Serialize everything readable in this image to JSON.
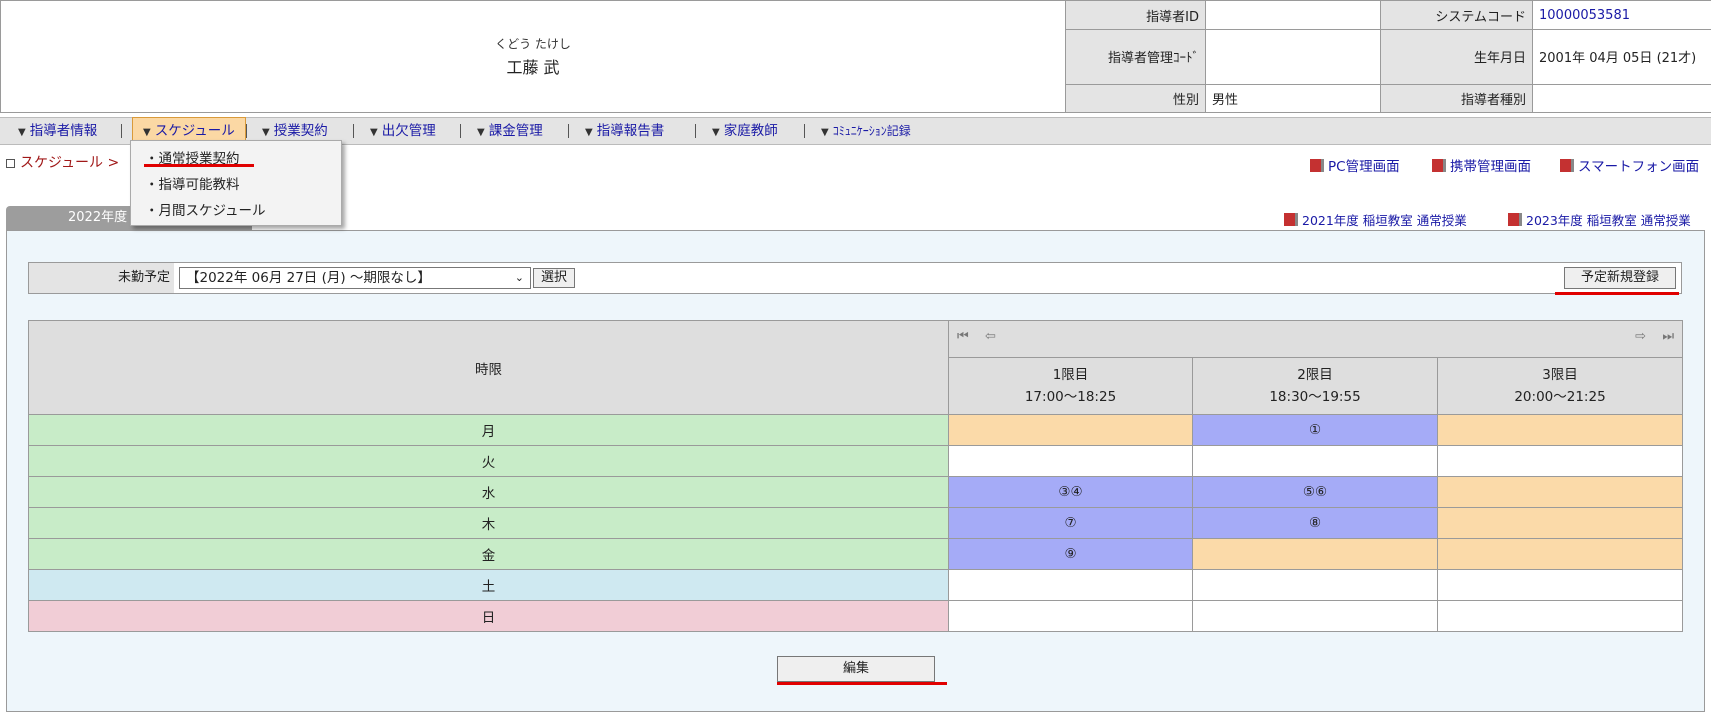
{
  "header": {
    "name_kana": "くどう たけし",
    "name_kanji": "工藤 武",
    "rows": [
      {
        "label1": "指導者ID",
        "value1": "",
        "label2": "システムコード",
        "value2": "10000053581"
      },
      {
        "label1": "指導者管理ｺｰﾄﾞ",
        "value1": "",
        "label2": "生年月日",
        "value2": "2001年 04月 05日 (21才)"
      },
      {
        "label1": "性別",
        "value1": "男性",
        "label2": "指導者種別",
        "value2": ""
      }
    ]
  },
  "nav": {
    "items": [
      "指導者情報",
      "スケジュール",
      "授業契約",
      "出欠管理",
      "課金管理",
      "指導報告書",
      "家庭教師",
      "ｺﾐｭﾆｹｰｼｮﾝ記録"
    ],
    "arrow": "▼",
    "active": "スケジュール"
  },
  "dropdown": {
    "items": [
      "・通常授業契約",
      "・指導可能教料",
      "・月間スケジュール"
    ]
  },
  "breadcrumb": "スケジュール >",
  "screen_links": [
    "PC管理画面",
    "携帯管理画面",
    "スマートフォン画面"
  ],
  "year_tab": "2022年度",
  "year_links": [
    "2021年度 稲垣教室 通常授業",
    "2023年度 稲垣教室 通常授業"
  ],
  "selection": {
    "label": "未勤予定",
    "value": "【2022年 06月 27日 (月) ～期限なし】",
    "select_button": "選択",
    "new_button": "予定新規登録"
  },
  "schedule": {
    "period_header": "時限",
    "nav_icons": [
      "first-icon",
      "prev-icon",
      "next-icon",
      "last-icon"
    ],
    "periods": [
      {
        "name": "1限目",
        "time": "17:00～18:25"
      },
      {
        "name": "2限目",
        "time": "18:30～19:55"
      },
      {
        "name": "3限目",
        "time": "20:00～21:25"
      }
    ],
    "days": [
      {
        "day": "月",
        "type": "weekday",
        "cells": [
          {
            "text": "",
            "color": "orange"
          },
          {
            "text": "①",
            "color": "blue"
          },
          {
            "text": "",
            "color": "orange"
          }
        ]
      },
      {
        "day": "火",
        "type": "weekday",
        "cells": [
          {
            "text": "",
            "color": "white"
          },
          {
            "text": "",
            "color": "white"
          },
          {
            "text": "",
            "color": "white"
          }
        ]
      },
      {
        "day": "水",
        "type": "weekday",
        "cells": [
          {
            "text": "③④",
            "color": "blue"
          },
          {
            "text": "⑤⑥",
            "color": "blue"
          },
          {
            "text": "",
            "color": "orange"
          }
        ]
      },
      {
        "day": "木",
        "type": "weekday",
        "cells": [
          {
            "text": "⑦",
            "color": "blue"
          },
          {
            "text": "⑧",
            "color": "blue"
          },
          {
            "text": "",
            "color": "orange"
          }
        ]
      },
      {
        "day": "金",
        "type": "weekday",
        "cells": [
          {
            "text": "⑨",
            "color": "blue"
          },
          {
            "text": "",
            "color": "orange"
          },
          {
            "text": "",
            "color": "orange"
          }
        ]
      },
      {
        "day": "土",
        "type": "sat",
        "cells": [
          {
            "text": "",
            "color": "white"
          },
          {
            "text": "",
            "color": "white"
          },
          {
            "text": "",
            "color": "white"
          }
        ]
      },
      {
        "day": "日",
        "type": "sun",
        "cells": [
          {
            "text": "",
            "color": "white"
          },
          {
            "text": "",
            "color": "white"
          },
          {
            "text": "",
            "color": "white"
          }
        ]
      }
    ]
  },
  "edit_button": "編集",
  "colors": {
    "orange": "#fbdaa9",
    "blue": "#a5abf7",
    "weekday": "#c8ecc8",
    "sat": "#cfe9f1",
    "sun": "#f1cdd6",
    "highlight": "#e00000"
  }
}
